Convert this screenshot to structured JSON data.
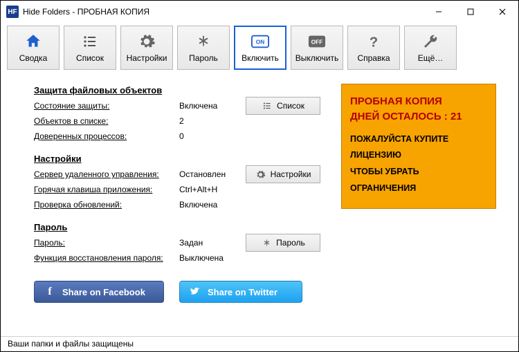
{
  "window": {
    "title": "Hide Folders - ПРОБНАЯ КОПИЯ",
    "app_icon_text": "HF"
  },
  "toolbar": [
    {
      "label": "Сводка"
    },
    {
      "label": "Список"
    },
    {
      "label": "Настройки"
    },
    {
      "label": "Пароль"
    },
    {
      "label": "Включить"
    },
    {
      "label": "Выключить"
    },
    {
      "label": "Справка"
    },
    {
      "label": "Ещё…"
    }
  ],
  "sections": {
    "protection": {
      "title": "Защита файловых объектов",
      "rows": [
        {
          "label": "Состояние защиты:",
          "value": "Включена"
        },
        {
          "label": "Объектов в списке:",
          "value": "2"
        },
        {
          "label": "Доверенных процессов:",
          "value": "0"
        }
      ],
      "button": "Список"
    },
    "settings": {
      "title": "Настройки",
      "rows": [
        {
          "label": "Сервер удаленного управления:",
          "value": "Остановлен"
        },
        {
          "label": "Горячая клавиша приложения:",
          "value": "Ctrl+Alt+H"
        },
        {
          "label": "Проверка обновлений:",
          "value": "Включена"
        }
      ],
      "button": "Настройки"
    },
    "password": {
      "title": "Пароль",
      "rows": [
        {
          "label": "Пароль:",
          "value": "Задан"
        },
        {
          "label": "Функция восстановления пароля:",
          "value": "Выключена"
        }
      ],
      "button": "Пароль"
    }
  },
  "trial": {
    "line1": "ПРОБНАЯ КОПИЯ",
    "line2": "ДНЕЙ ОСТАЛОСЬ : 21",
    "body1": "ПОЖАЛУЙСТА КУПИТЕ",
    "body2": "ЛИЦЕНЗИЮ",
    "body3": "ЧТОБЫ УБРАТЬ",
    "body4": "ОГРАНИЧЕНИЯ"
  },
  "share": {
    "facebook": "Share on Facebook",
    "twitter": "Share on Twitter"
  },
  "status": "Ваши папки и файлы защищены"
}
